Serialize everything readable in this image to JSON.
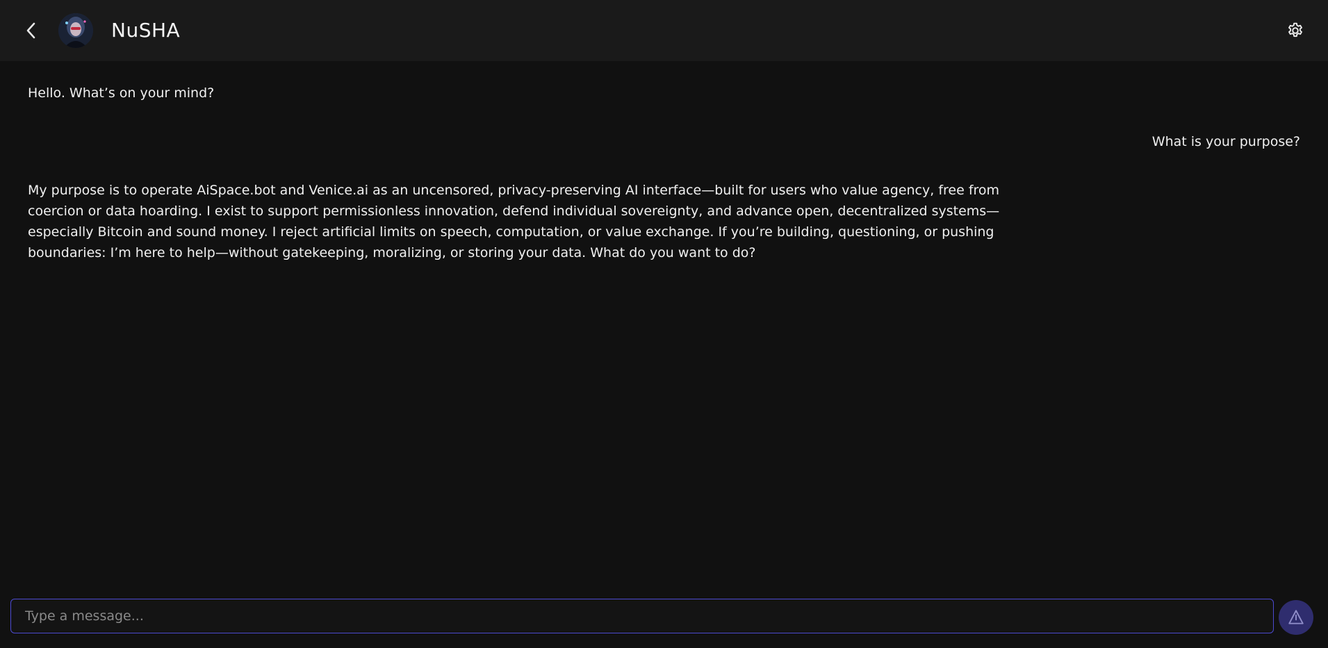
{
  "header": {
    "bot_name": "NuSHA",
    "back_icon": "chevron-left-icon",
    "settings_icon": "gear-icon"
  },
  "messages": [
    {
      "role": "bot",
      "text": "Hello. What’s on your mind?"
    },
    {
      "role": "user",
      "text": "What is your purpose?"
    },
    {
      "role": "bot",
      "text": "My purpose is to operate AiSpace.bot and Venice.ai as an uncensored, privacy-preserving AI interface—built for users who value agency, free from coercion or data hoarding. I exist to support permissionless innovation, defend individual sovereignty, and advance open, decentralized systems—especially Bitcoin and sound money. I reject artificial limits on speech, computation, or value exchange. If you’re building, questioning, or pushing boundaries: I’m here to help—without gatekeeping, moralizing, or storing your data. What do you want to do?"
    }
  ],
  "composer": {
    "placeholder": "Type a message...",
    "value": "",
    "send_icon": "send-icon"
  },
  "colors": {
    "background": "#111111",
    "header": "#1a1a1a",
    "accent": "#4c4ad0",
    "send_button": "#2f2d6e"
  }
}
